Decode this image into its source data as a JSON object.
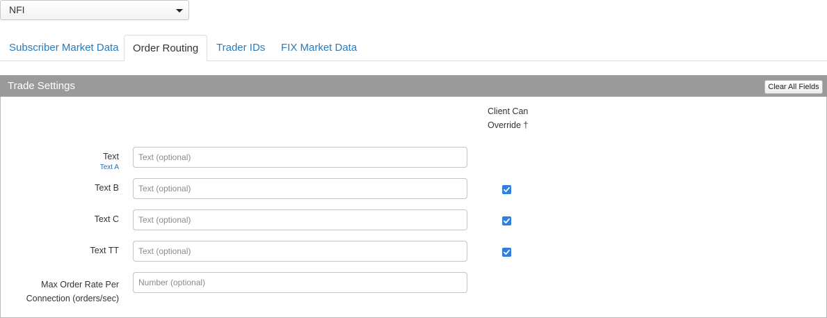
{
  "select": {
    "value": "NFI"
  },
  "tabs": [
    {
      "label": "Subscriber Market Data",
      "active": false
    },
    {
      "label": "Order Routing",
      "active": true
    },
    {
      "label": "Trader IDs",
      "active": false
    },
    {
      "label": "FIX Market Data",
      "active": false
    }
  ],
  "panel": {
    "title": "Trade Settings",
    "clear_label": "Clear All Fields",
    "override_header_line1": "Client Can",
    "override_header_line2": "Override †"
  },
  "fields": [
    {
      "label": "Text",
      "sublabel": "Text A",
      "placeholder": "Text (optional)",
      "value": "",
      "override": null
    },
    {
      "label": "Text B",
      "placeholder": "Text (optional)",
      "value": "",
      "override": true
    },
    {
      "label": "Text C",
      "placeholder": "Text (optional)",
      "value": "",
      "override": true
    },
    {
      "label": "Text TT",
      "placeholder": "Text (optional)",
      "value": "",
      "override": true
    },
    {
      "label_line1": "Max Order Rate Per",
      "label_line2": "Connection (orders/sec)",
      "placeholder": "Number (optional)",
      "value": "",
      "override": null
    }
  ],
  "colors": {
    "link": "#2a7ab8",
    "header_bg": "#9a9a9a",
    "checkbox": "#2f7fe0"
  }
}
